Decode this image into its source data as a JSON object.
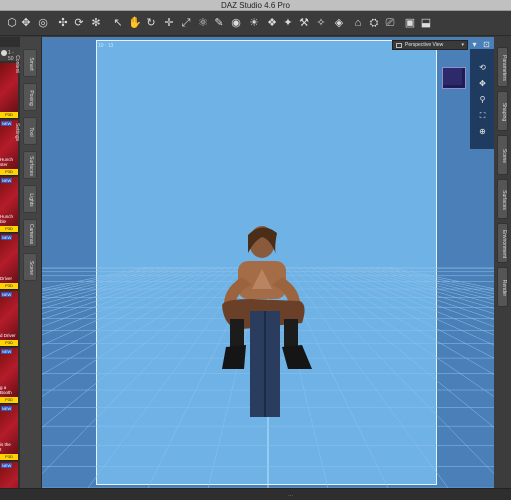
{
  "window": {
    "title": "DAZ Studio 4.6 Pro"
  },
  "toolbar": {
    "tools": [
      {
        "name": "universal-tool-icon",
        "glyph": "⬡"
      },
      {
        "name": "rotate-tool-icon",
        "glyph": "✥"
      },
      {
        "name": "node-select-icon",
        "glyph": "◎"
      },
      {
        "name": "translate-tool-icon",
        "glyph": "✣"
      },
      {
        "name": "joint-editor-icon",
        "glyph": "⟳"
      },
      {
        "name": "geometry-tool-icon",
        "glyph": "✻"
      },
      {
        "name": "pointer-tool-icon",
        "glyph": "↖"
      },
      {
        "name": "pose-tool-icon",
        "glyph": "✋"
      },
      {
        "name": "orbit-tool-icon",
        "glyph": "↻"
      },
      {
        "name": "move-tool-icon",
        "glyph": "✛"
      },
      {
        "name": "scale-tool-icon",
        "glyph": "⤢"
      },
      {
        "name": "surface-tool-icon",
        "glyph": "⚛"
      },
      {
        "name": "shaping-tool-icon",
        "glyph": "✎"
      },
      {
        "name": "camera-tool-icon",
        "glyph": "◉"
      },
      {
        "name": "light-tool-icon",
        "glyph": "☀"
      },
      {
        "name": "skin-tool-icon",
        "glyph": "❖"
      },
      {
        "name": "spotlight-icon",
        "glyph": "✦"
      },
      {
        "name": "brush-tool-icon",
        "glyph": "⚒"
      },
      {
        "name": "paint-tool-icon",
        "glyph": "✧"
      },
      {
        "name": "morph-tool-icon",
        "glyph": "◈"
      },
      {
        "name": "render-icon",
        "glyph": "⌂"
      },
      {
        "name": "lamp-icon",
        "glyph": "⛭"
      },
      {
        "name": "render-settings-icon",
        "glyph": "⎚"
      },
      {
        "name": "screenshot-icon",
        "glyph": "▣"
      },
      {
        "name": "spot-render-icon",
        "glyph": "⬓"
      }
    ]
  },
  "content_library": {
    "page_range": "1 - 50",
    "assets": [
      {
        "badge": "P3D",
        "new": "",
        "label": ""
      },
      {
        "badge": "P3D",
        "new": "NEW",
        "label": "Hunch\nster"
      },
      {
        "badge": "P3D",
        "new": "NEW",
        "label": "Hunch\nble"
      },
      {
        "badge": "P3D",
        "new": "NEW",
        "label": "Driver"
      },
      {
        "badge": "P3D",
        "new": "NEW",
        "label": "d Driver"
      },
      {
        "badge": "P3D",
        "new": "NEW",
        "label": "g a\nBooth"
      },
      {
        "badge": "P3D",
        "new": "NEW",
        "label": "is the\nt"
      },
      {
        "badge": "P3D",
        "new": "NEW",
        "label": "e\nation"
      }
    ]
  },
  "left_tabs": [
    "Smart Content",
    "Posing",
    "Tool Settings",
    "Surfaces",
    "Lights",
    "Cameras",
    "Scene"
  ],
  "viewport": {
    "aspect_label": "10 : 13",
    "camera_label": "Perspective View",
    "camera_arrow": "▾",
    "background_color": "#6fb2e6",
    "frame_border": "#e8f2fb"
  },
  "right_tabs": [
    "Parameters",
    "Shaping",
    "Scene",
    "Surfaces",
    "Environment",
    "Render"
  ],
  "status": {
    "grip": "..."
  }
}
